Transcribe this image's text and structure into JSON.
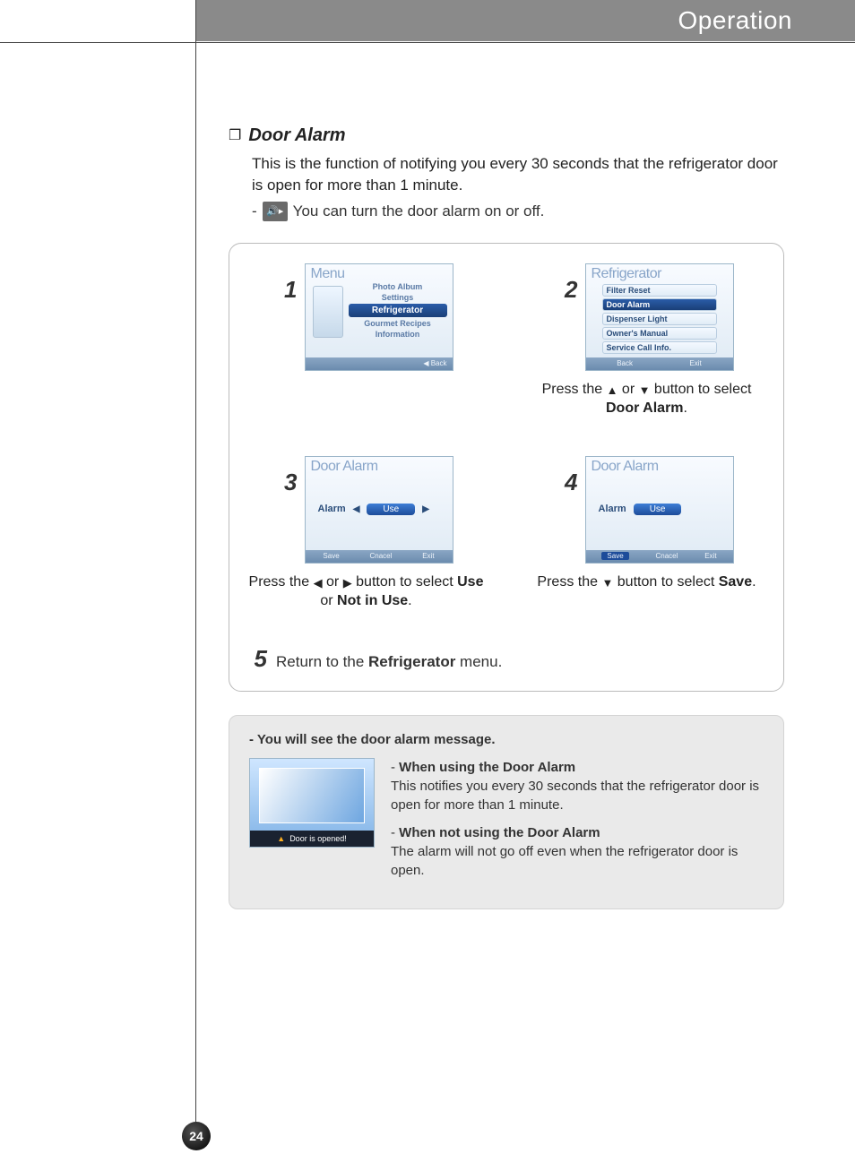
{
  "header": {
    "title": "Operation"
  },
  "page_number": "24",
  "section": {
    "title": "Door Alarm",
    "intro": "This is the function of notifying you every 30 seconds that the refrigerator door is open for more than 1 minute.",
    "toggle_note_prefix": "-",
    "toggle_note": "You can turn the door alarm on or off."
  },
  "steps": {
    "s1": {
      "num": "1",
      "screen_title": "Menu",
      "items": [
        "Photo Album",
        "Settings",
        "Refrigerator",
        "Gourmet Recipes",
        "Information"
      ],
      "selected": "Refrigerator",
      "back_label": "◀ Back"
    },
    "s2": {
      "num": "2",
      "screen_title": "Refrigerator",
      "items": [
        "Filter Reset",
        "Door Alarm",
        "Dispenser Light",
        "Owner's Manual",
        "Service Call Info."
      ],
      "selected": "Door Alarm",
      "bottom": {
        "back": "Back",
        "exit": "Exit"
      },
      "caption_a": "Press the ",
      "caption_b": " or ",
      "caption_c": " button to select ",
      "caption_bold": "Door Alarm",
      "caption_end": "."
    },
    "s3": {
      "num": "3",
      "screen_title": "Door Alarm",
      "alarm_label": "Alarm",
      "value": "Use",
      "bottom": {
        "save": "Save",
        "cancel": "Cnacel",
        "exit": "Exit"
      },
      "caption_a": "Press the",
      "caption_b": "or",
      "caption_c": "button to select ",
      "caption_bold1": "Use",
      "caption_mid": " or ",
      "caption_bold2": "Not in Use",
      "caption_end": "."
    },
    "s4": {
      "num": "4",
      "screen_title": "Door Alarm",
      "alarm_label": "Alarm",
      "value": "Use",
      "bottom": {
        "save": "Save",
        "cancel": "Cnacel",
        "exit": "Exit"
      },
      "caption_a": "Press the ",
      "caption_b": " button to select ",
      "caption_bold": "Save",
      "caption_end": "."
    },
    "s5": {
      "num": "5",
      "text_a": "Return to the ",
      "text_bold": "Refrigerator",
      "text_b": " menu."
    }
  },
  "info": {
    "title": "- You will see the door alarm message.",
    "popup_text": "Door is opened!",
    "using_title": "When using the Door Alarm",
    "using_body": "This notifies you every 30 seconds that the refrigerator door is open for more than 1 minute.",
    "notusing_title": "When not using the Door Alarm",
    "notusing_body": "The alarm will not go off even when the refrigerator door is open."
  }
}
